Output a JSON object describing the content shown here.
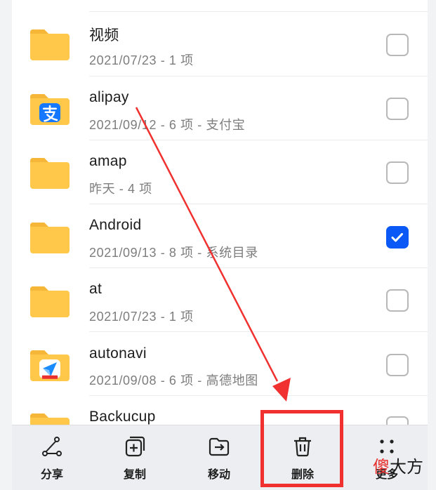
{
  "files": [
    {
      "name": "",
      "meta": "",
      "checked": false,
      "badge": ""
    },
    {
      "name": "视频",
      "meta": "2021/07/23 - 1 项",
      "checked": false,
      "badge": ""
    },
    {
      "name": "alipay",
      "meta": "2021/09/12 - 6 项 - 支付宝",
      "checked": false,
      "badge": "alipay-icon"
    },
    {
      "name": "amap",
      "meta": "昨天 - 4 项",
      "checked": false,
      "badge": ""
    },
    {
      "name": "Android",
      "meta": "2021/09/13 - 8 项 - 系统目录",
      "checked": true,
      "badge": ""
    },
    {
      "name": "at",
      "meta": "2021/07/23 - 1 项",
      "checked": false,
      "badge": ""
    },
    {
      "name": "autonavi",
      "meta": "2021/09/08 - 6 项 - 高德地图",
      "checked": false,
      "badge": "amap-nav-icon"
    },
    {
      "name": "Backucup",
      "meta": "",
      "checked": false,
      "badge": ""
    }
  ],
  "toolbar": {
    "share": "分享",
    "copy": "复制",
    "move": "移动",
    "delete": "删除",
    "more": "更多"
  },
  "watermark": {
    "accent": "傻",
    "rest": "大方"
  },
  "colors": {
    "folder": "#ffc84a",
    "folder_tab": "#f6b637",
    "checkbox_checked": "#0a59f7",
    "annotation": "#f0312f"
  }
}
